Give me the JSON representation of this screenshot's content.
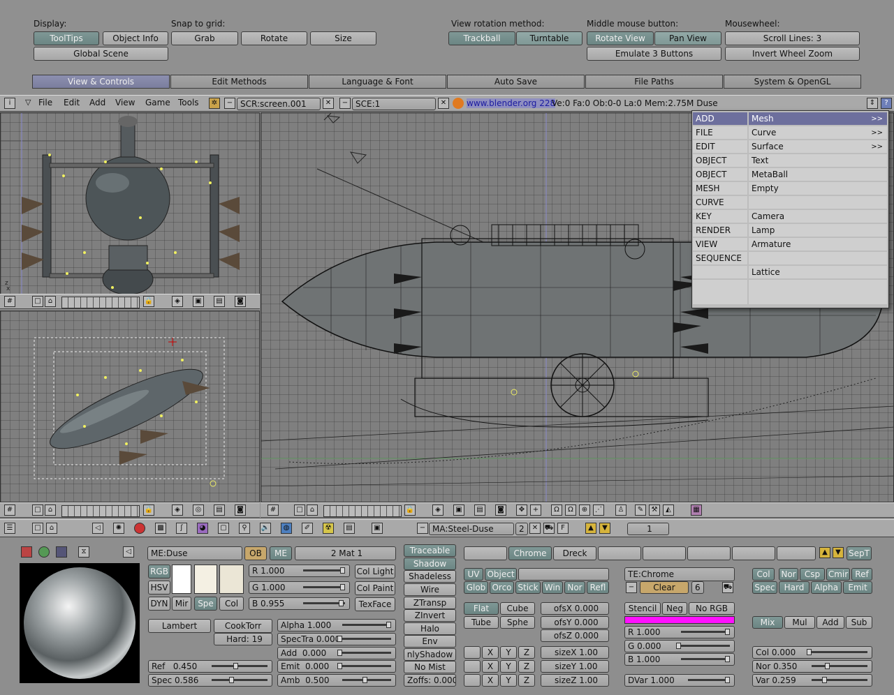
{
  "prefs": {
    "display_label": "Display:",
    "tooltips": "ToolTips",
    "object_info": "Object Info",
    "global_scene": "Global Scene",
    "snap_label": "Snap to grid:",
    "grab": "Grab",
    "rotate": "Rotate",
    "size": "Size",
    "view_rot_label": "View rotation method:",
    "trackball": "Trackball",
    "turntable": "Turntable",
    "mmb_label": "Middle mouse button:",
    "rotate_view": "Rotate View",
    "pan_view": "Pan View",
    "emulate3": "Emulate 3 Buttons",
    "wheel_label": "Mousewheel:",
    "scroll_lines": "Scroll Lines: 3",
    "invert_zoom": "Invert Wheel Zoom",
    "tabs": [
      "View & Controls",
      "Edit Methods",
      "Language & Font",
      "Auto Save",
      "File Paths",
      "System & OpenGL"
    ]
  },
  "menubar": {
    "menus": [
      "File",
      "Edit",
      "Add",
      "View",
      "Game",
      "Tools"
    ],
    "screen": "SCR:screen.001",
    "scene": "SCE:1",
    "url": "www.blender.org 228",
    "stats": "Ve:0 Fa:0  Ob:0-0 La:0  Mem:2.75M   Duse"
  },
  "addmenu": {
    "left": [
      "ADD",
      "FILE",
      "EDIT",
      "OBJECT",
      "OBJECT",
      "MESH",
      "CURVE",
      "KEY",
      "RENDER",
      "VIEW",
      "SEQUENCE",
      "",
      ""
    ],
    "right": [
      "Mesh",
      "Curve",
      "Surface",
      "Text",
      "MetaBall",
      "Empty",
      "",
      "Camera",
      "Lamp",
      "Armature",
      "",
      "Lattice",
      ""
    ],
    "more": ">>"
  },
  "buttons_header": {
    "material": "MA:Steel-Duse",
    "users": "2",
    "frame": "1"
  },
  "material": {
    "me_name": "ME:Duse",
    "ob": "OB",
    "me": "ME",
    "mat_count": "2 Mat 1",
    "rgb": "RGB",
    "hsv": "HSV",
    "dyn": "DYN",
    "mir": "Mir",
    "spe": "Spe",
    "col": "Col",
    "r": "R 1.000",
    "g": "G 1.000",
    "b": "B 0.955",
    "col_light": "Col Light",
    "col_paint": "Col Paint",
    "texface": "TexFace",
    "lambert": "Lambert",
    "cooktorr": "CookTorr",
    "hard": "Hard: 19",
    "ref": "Ref",
    "ref_val": "0.450",
    "spec": "Spec",
    "spec_val": "0.586",
    "alpha": "Alpha 1.000",
    "spectra": "SpecTra 0.000",
    "add": "Add",
    "add_val": "0.000",
    "emit": "Emit",
    "emit_val": "0.000",
    "amb": "Amb",
    "amb_val": "0.500",
    "toggles": [
      "Traceable",
      "Shadow",
      "Shadeless",
      "Wire",
      "ZTransp",
      "ZInvert",
      "Halo",
      "Env",
      "nlyShadow",
      "No Mist",
      "Zoffs: 0.000"
    ],
    "swatch_colors": [
      "#ffffff",
      "#f4f0e3",
      "#ebe6d6"
    ]
  },
  "texture": {
    "slots": [
      "",
      "Chrome",
      "Dreck",
      "",
      "",
      "",
      "",
      ""
    ],
    "sep": "SepT",
    "uv": "UV",
    "object": "Object",
    "glob": "Glob",
    "orco": "Orco",
    "stick": "Stick",
    "win": "Win",
    "nor": "Nor",
    "refl": "Refl",
    "flat": "Flat",
    "cube": "Cube",
    "tube": "Tube",
    "sphe": "Sphe",
    "ofsx": "ofsX 0.000",
    "ofsy": "ofsY 0.000",
    "ofsz": "ofsZ 0.000",
    "sizex": "sizeX 1.00",
    "sizey": "sizeY 1.00",
    "sizez": "sizeZ 1.00",
    "x": "X",
    "y": "Y",
    "z": "Z",
    "te": "TE:Chrome",
    "clear": "Clear",
    "clear_num": "6",
    "stencil": "Stencil",
    "neg": "Neg",
    "norgb": "No RGB",
    "tr": "R 1.000",
    "tg": "G 0.000",
    "tb": "B 1.000",
    "dvar": "DVar 1.000",
    "pink": "#ff10ff"
  },
  "mapto": {
    "row1": [
      "Col",
      "Nor",
      "Csp",
      "Cmir",
      "Ref"
    ],
    "row2": [
      "Spec",
      "Hard",
      "Alpha",
      "Emit"
    ],
    "blend": [
      "Mix",
      "Mul",
      "Add",
      "Sub"
    ],
    "col": "Col 0.000",
    "nor": "Nor 0.350",
    "var": "Var 0.259"
  }
}
